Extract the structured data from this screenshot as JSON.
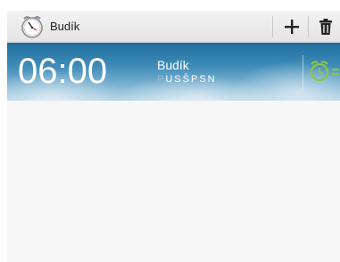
{
  "action_bar": {
    "title": "Budík",
    "app_icon": "alarm-clock-icon",
    "add_icon": "plus-icon",
    "delete_icon": "trash-icon"
  },
  "alarm": {
    "time": "06:00",
    "name": "Budík",
    "days": [
      {
        "letter": "P",
        "active": false
      },
      {
        "letter": "U",
        "active": true
      },
      {
        "letter": "S",
        "active": true
      },
      {
        "letter": "Š",
        "active": true
      },
      {
        "letter": "P",
        "active": true
      },
      {
        "letter": "S",
        "active": true
      },
      {
        "letter": "N",
        "active": true
      }
    ],
    "toggle_icon": "alarm-on-icon",
    "enabled": true
  },
  "colors": {
    "accent_green": "#8cc63f",
    "sky_dark": "#1f6e9c",
    "day_inactive": "#8fc0dd"
  }
}
